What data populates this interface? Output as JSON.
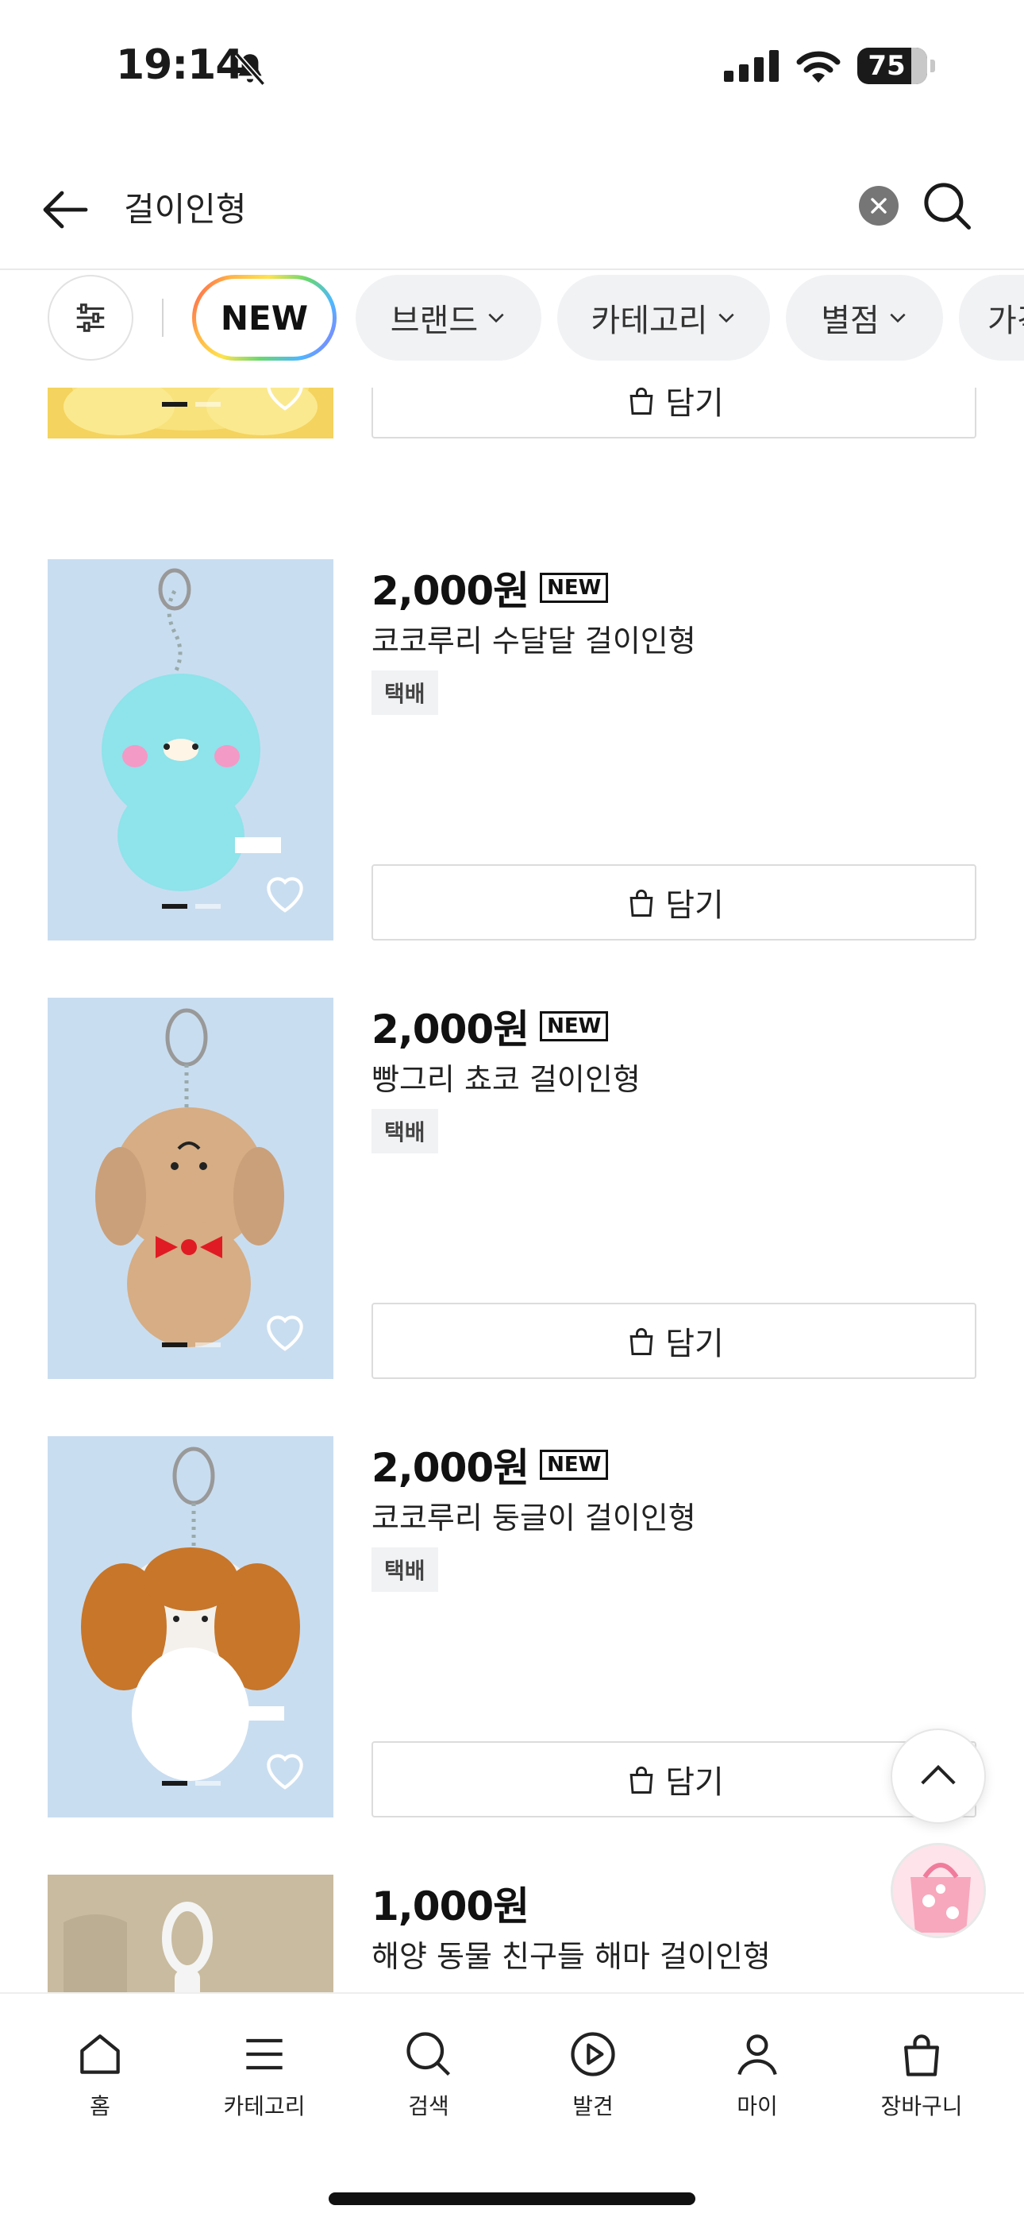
{
  "status_bar": {
    "time": "19:14",
    "battery": "75"
  },
  "search": {
    "query": "걸이인형"
  },
  "filters": {
    "chips": [
      {
        "label": "NEW"
      },
      {
        "label": "브랜드"
      },
      {
        "label": "카테고리"
      },
      {
        "label": "별점"
      },
      {
        "label": "가격"
      }
    ]
  },
  "products": [
    {
      "add_label": "담기"
    },
    {
      "price": "2,000원",
      "badge": "NEW",
      "name": "코코루리 수달달 걸이인형",
      "shipping": "택배",
      "add_label": "담기"
    },
    {
      "price": "2,000원",
      "badge": "NEW",
      "name": "빵그리 쵸코 걸이인형",
      "shipping": "택배",
      "add_label": "담기"
    },
    {
      "price": "2,000원",
      "badge": "NEW",
      "name": "코코루리 둥글이 걸이인형",
      "shipping": "택배",
      "add_label": "담기"
    },
    {
      "price": "1,000원",
      "name": "해양 동물 친구들 해마 걸이인형"
    }
  ],
  "bottom_nav": {
    "items": [
      {
        "label": "홈",
        "icon": "home-icon"
      },
      {
        "label": "카테고리",
        "icon": "menu-icon"
      },
      {
        "label": "검색",
        "icon": "search-icon"
      },
      {
        "label": "발견",
        "icon": "play-icon"
      },
      {
        "label": "마이",
        "icon": "person-icon"
      },
      {
        "label": "장바구니",
        "icon": "bag-icon"
      }
    ]
  },
  "colors": {
    "accent": "#111111",
    "chip_bg": "#f1f2f4",
    "thumb_bg": "#c9ddf0"
  }
}
